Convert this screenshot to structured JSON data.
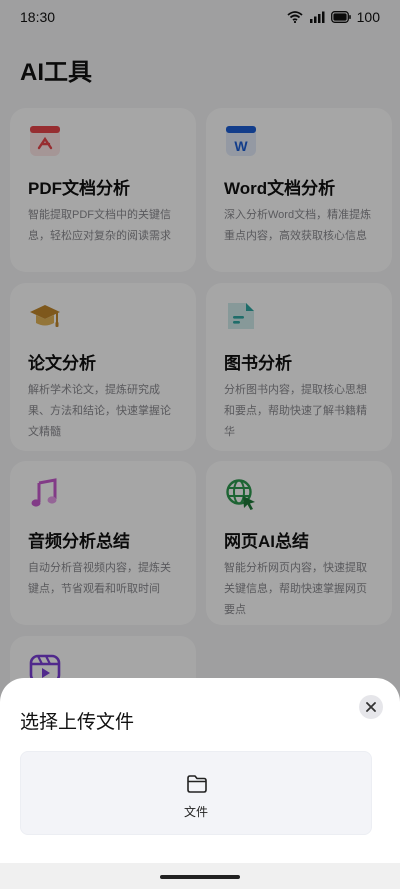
{
  "status": {
    "time": "18:30",
    "battery": "100"
  },
  "header": {
    "title": "AI工具"
  },
  "tools": [
    {
      "title": "PDF文档分析",
      "desc": "智能提取PDF文档中的关键信息，轻松应对复杂的阅读需求",
      "icon": "pdf-icon"
    },
    {
      "title": "Word文档分析",
      "desc": "深入分析Word文档，精准提炼重点内容，高效获取核心信息",
      "icon": "word-icon"
    },
    {
      "title": "论文分析",
      "desc": "解析学术论文，提炼研究成果、方法和结论，快速掌握论文精髓",
      "icon": "graduation-cap-icon"
    },
    {
      "title": "图书分析",
      "desc": "分析图书内容，提取核心思想和要点，帮助快速了解书籍精华",
      "icon": "book-document-icon"
    },
    {
      "title": "音频分析总结",
      "desc": "自动分析音视频内容，提炼关键点，节省观看和听取时间",
      "icon": "music-note-icon"
    },
    {
      "title": "网页AI总结",
      "desc": "智能分析网页内容，快速提取关键信息，帮助快速掌握网页要点",
      "icon": "web-globe-icon"
    },
    {
      "title": "",
      "desc": "",
      "icon": "video-icon"
    }
  ],
  "sheet": {
    "title": "选择上传文件",
    "file_label": "文件"
  },
  "colors": {
    "pdf": "#e8454a",
    "word": "#1c5fd6",
    "cap": "#c2882b",
    "book": "#31a8a4",
    "music": "#c85bd0",
    "web": "#2d9a4f",
    "video": "#7b3fd8"
  }
}
